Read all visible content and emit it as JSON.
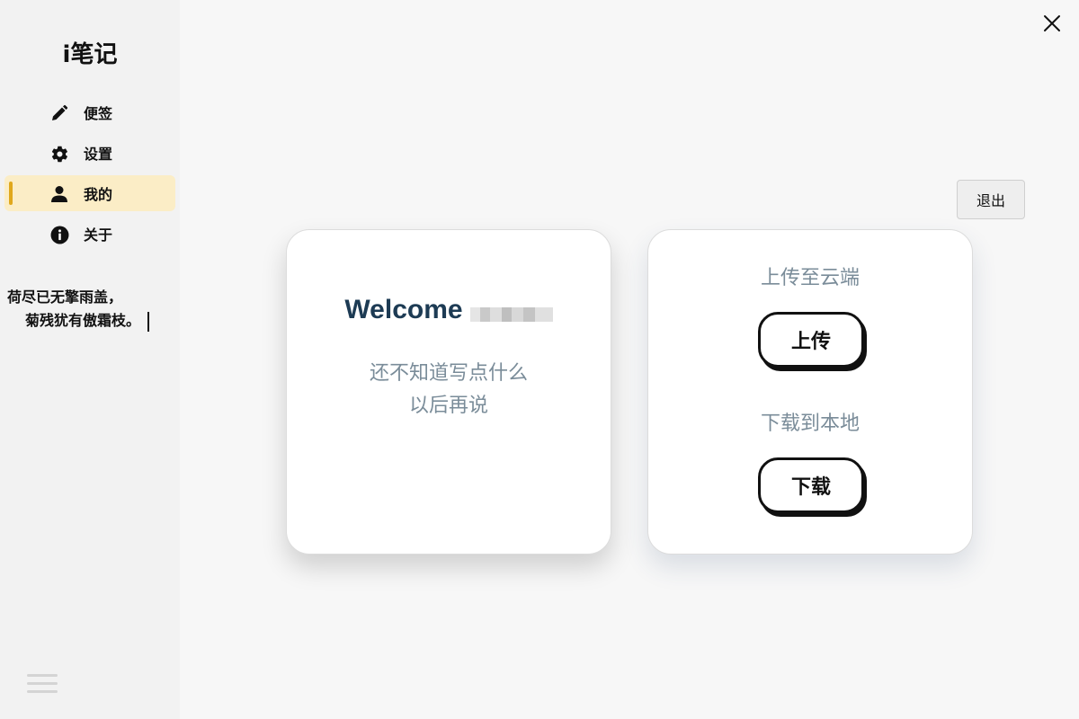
{
  "app": {
    "title": "i笔记"
  },
  "sidebar": {
    "items": [
      {
        "label": "便签",
        "icon": "pencil-icon",
        "active": false
      },
      {
        "label": "设置",
        "icon": "gear-icon",
        "active": false
      },
      {
        "label": "我的",
        "icon": "user-icon",
        "active": true
      },
      {
        "label": "关于",
        "icon": "info-icon",
        "active": false
      }
    ],
    "poem": {
      "line1": "荷尽已无擎雨盖，",
      "line2": "菊残犹有傲霜枝。"
    },
    "menu_icon": "hamburger-menu-icon"
  },
  "window": {
    "close_icon": "close-icon"
  },
  "header": {
    "logout_label": "退出"
  },
  "welcome_card": {
    "greeting": "Welcome",
    "message_line1": "还不知道写点什么",
    "message_line2": "以后再说"
  },
  "sync_card": {
    "upload_caption": "上传至云端",
    "upload_button": "上传",
    "download_caption": "下载到本地",
    "download_button": "下载"
  },
  "colors": {
    "accent": "#e0a81c",
    "active_bg": "#fbedc6",
    "heading": "#1d3b54",
    "muted_text": "#7a8c99"
  }
}
